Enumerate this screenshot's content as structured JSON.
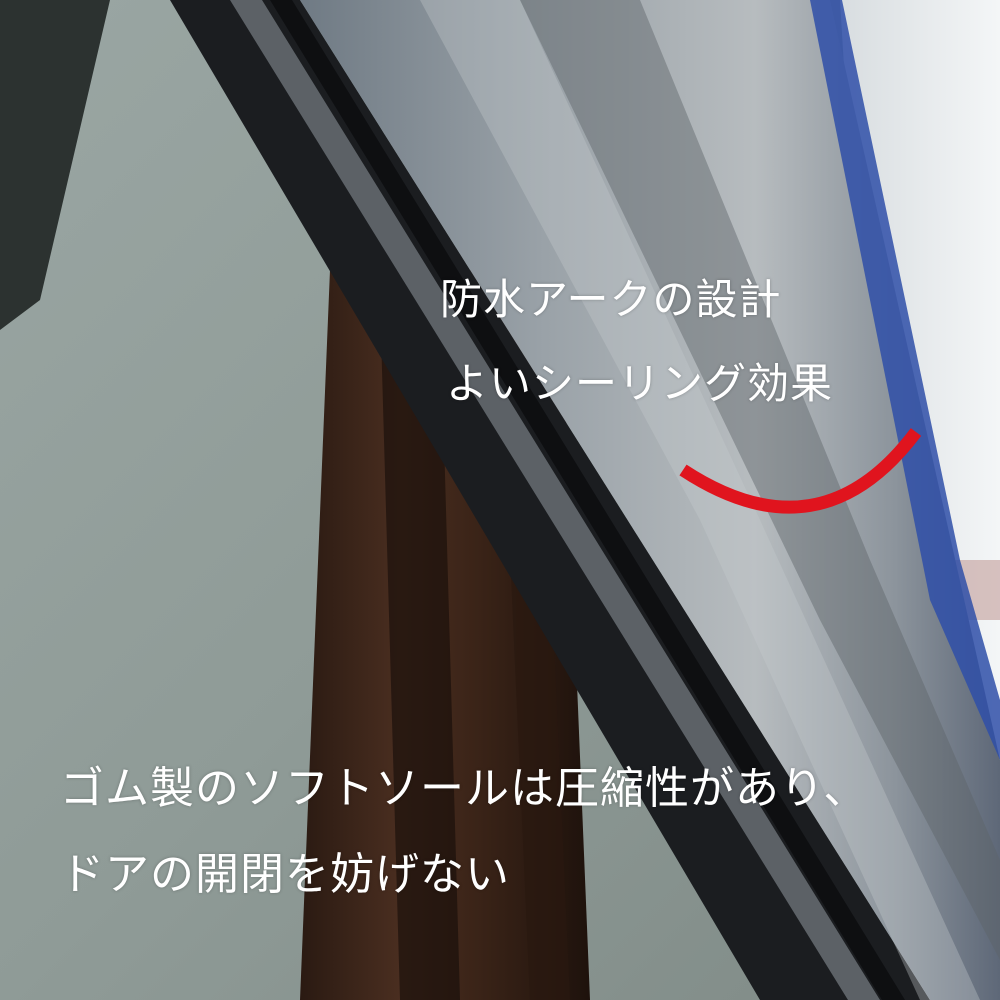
{
  "annotations": {
    "top_line_1": "防水アークの設計",
    "top_line_2": "よいシーリング効果",
    "bottom_line_1": "ゴム製のソフトソールは圧縮性があり、",
    "bottom_line_2": "ドアの開閉を妨げない"
  },
  "colors": {
    "arc_marker": "#e0141e",
    "caption_text": "#ffffff",
    "seal_edge_blue": "#2f4fa8"
  },
  "icons": {
    "arc_marker": "red-arc-icon"
  }
}
